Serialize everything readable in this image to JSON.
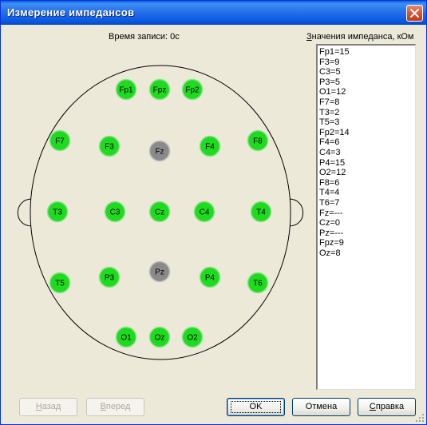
{
  "window": {
    "title": "Измерение импедансов"
  },
  "recording_time": "Время записи: 0с",
  "impedance_title": "Значения импеданса, кОм",
  "impedance_values": [
    "Fp1=15",
    "F3=9",
    "C3=5",
    "P3=5",
    "O1=12",
    "F7=8",
    "T3=2",
    "T5=3",
    "Fp2=14",
    "F4=6",
    "C4=3",
    "P4=15",
    "O2=12",
    "F8=6",
    "T4=4",
    "T6=7",
    "Fz=---",
    "Cz=0",
    "Pz=---",
    "Fpz=9",
    "Oz=8"
  ],
  "colors": {
    "good": "#1edb1e",
    "bad": "#8a8a8a",
    "titlebar": "#0a58e0"
  },
  "electrodes": [
    {
      "label": "Fp1",
      "status": "good"
    },
    {
      "label": "Fpz",
      "status": "good"
    },
    {
      "label": "Fp2",
      "status": "good"
    },
    {
      "label": "F7",
      "status": "good"
    },
    {
      "label": "F3",
      "status": "good"
    },
    {
      "label": "Fz",
      "status": "bad"
    },
    {
      "label": "F4",
      "status": "good"
    },
    {
      "label": "F8",
      "status": "good"
    },
    {
      "label": "T3",
      "status": "good"
    },
    {
      "label": "C3",
      "status": "good"
    },
    {
      "label": "Cz",
      "status": "good"
    },
    {
      "label": "C4",
      "status": "good"
    },
    {
      "label": "T4",
      "status": "good"
    },
    {
      "label": "T5",
      "status": "good"
    },
    {
      "label": "P3",
      "status": "good"
    },
    {
      "label": "Pz",
      "status": "bad"
    },
    {
      "label": "P4",
      "status": "good"
    },
    {
      "label": "T6",
      "status": "good"
    },
    {
      "label": "O1",
      "status": "good"
    },
    {
      "label": "Oz",
      "status": "good"
    },
    {
      "label": "O2",
      "status": "good"
    }
  ],
  "buttons": {
    "back": "Назад",
    "forward": "Вперед",
    "ok": "OK",
    "cancel": "Отмена",
    "help": "Справка"
  }
}
